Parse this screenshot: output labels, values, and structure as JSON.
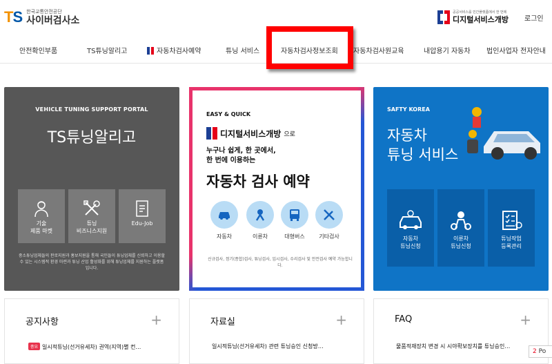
{
  "header": {
    "logo_mark": "TS",
    "org_sub": "한국교통안전공단",
    "org_main": "사이버검사소",
    "dgs_sub": "공공서비스를 민간플랫폼에서 한 번에",
    "dgs_main": "디지털서비스개방",
    "login": "로그인"
  },
  "nav": {
    "items": [
      {
        "label": "안전확인부품"
      },
      {
        "label": "TS튜닝알리고"
      },
      {
        "label": "자동차검사예약"
      },
      {
        "label": "튜닝 서비스"
      },
      {
        "label": "자동차검사정보조회"
      },
      {
        "label": "자동차검사원교육"
      },
      {
        "label": "내압용기 자동차"
      },
      {
        "label": "법인사업자 전자안내"
      }
    ]
  },
  "card1": {
    "eyebrow": "VEHICLE TUNING SUPPORT PORTAL",
    "title": "TS튜닝알리고",
    "tiles": [
      {
        "line1": "기술",
        "line2": "제품 마켓",
        "icon": "mechanic-icon"
      },
      {
        "line1": "튜닝",
        "line2": "비즈니스지원",
        "icon": "tools-icon"
      },
      {
        "line1": "Edu-Job",
        "line2": "",
        "icon": "document-icon"
      }
    ],
    "desc": "중소튜닝업체들의 판로지원과 홍보지원을 통해 국민들이 튜닝업체를 신뢰하고 이용할 수 있는 시스템적 환경 마련과 튜닝 산업 활성화를 위해 튜닝업체를 지원하는 플랫폼입니다."
  },
  "card2": {
    "eyebrow": "EASY & QUICK",
    "brand": "디지털서비스개방",
    "brand_suffix": "으로",
    "line1": "누구나 쉽게, 한 곳에서,",
    "line2": "한 번에 이용하는",
    "title": "자동차 검사 예약",
    "services": [
      {
        "label": "자동차",
        "icon": "car-icon"
      },
      {
        "label": "이륜차",
        "icon": "motorcycle-icon"
      },
      {
        "label": "대형버스",
        "icon": "bus-icon"
      },
      {
        "label": "기타검사",
        "icon": "tools-icon"
      }
    ],
    "desc": "신규검사, 정기(종합)검사, 튜닝검사, 임시검사, 수리검사 및 안전검사 예약 가능합니다."
  },
  "card3": {
    "eyebrow": "SAFTY KOREA",
    "title_line1": "자동차",
    "title_line2": "튜닝 서비스",
    "tiles": [
      {
        "line1": "자동차",
        "line2": "튜닝신청",
        "icon": "car-tuning-icon"
      },
      {
        "line1": "이륜차",
        "line2": "튜닝신청",
        "icon": "motorcycle-rider-icon"
      },
      {
        "line1": "튜닝작업",
        "line2": "등록관리",
        "icon": "checklist-icon"
      }
    ]
  },
  "panels": [
    {
      "title": "공지사항",
      "badge": "중요",
      "item": "일시적튜닝(선거유세차) 권역(지역)별 컨…"
    },
    {
      "title": "자료실",
      "badge": "",
      "item": "일시적튜닝(선거유세차) 관련 튜닝승인 신청방…"
    },
    {
      "title": "FAQ",
      "badge": "",
      "item": "물품적재장치 변경 시 시야확보장치를 튜닝승인…"
    }
  ],
  "popup": {
    "count": "2",
    "label": "Po"
  },
  "colors": {
    "highlight": "#ff0000",
    "card1_bg": "#575757",
    "card3_bg": "#0f74c6",
    "accent_red": "#e50019",
    "accent_blue": "#1c3f94"
  }
}
